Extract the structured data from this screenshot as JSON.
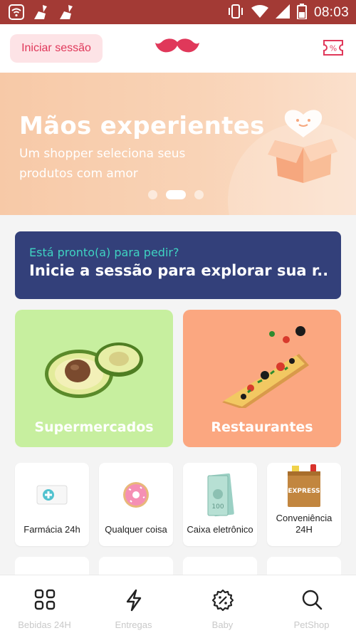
{
  "status_bar": {
    "time": "08:03",
    "icons": [
      "wifi-box-icon",
      "broom-icon",
      "broom-icon",
      "vibrate-icon",
      "wifi-icon",
      "signal-icon",
      "battery-icon"
    ]
  },
  "header": {
    "login_label": "Iniciar sessão",
    "logo": "mustache-logo",
    "coupon_icon": "coupon-percent-icon"
  },
  "banner": {
    "title": "Mãos experientes",
    "subtitle": "Um shopper seleciona seus produtos com amor",
    "slide_count": 3,
    "active_slide": 2
  },
  "cta": {
    "question": "Está pronto(a) para pedir?",
    "main": "Inicie a sessão para explorar sua r..."
  },
  "categories": [
    {
      "label": "Supermercados",
      "color": "#c7ef9f"
    },
    {
      "label": "Restaurantes",
      "color": "#fba780"
    }
  ],
  "small_categories": [
    {
      "label": "Farmácia 24h"
    },
    {
      "label": "Qualquer coisa"
    },
    {
      "label": "Caixa eletrônico"
    },
    {
      "label": "Conveniência 24H"
    }
  ],
  "bottom_nav": [
    {
      "label": "Bebidas 24H",
      "icon": "grid-icon"
    },
    {
      "label": "Entregas",
      "icon": "lightning-icon"
    },
    {
      "label": "Baby",
      "icon": "discount-badge-icon"
    },
    {
      "label": "PetShop",
      "icon": "search-icon"
    }
  ],
  "colors": {
    "status_bar": "#a33a35",
    "brand": "#e0385a",
    "cta_bg": "#33407a",
    "cta_accent": "#3fd3c2"
  }
}
